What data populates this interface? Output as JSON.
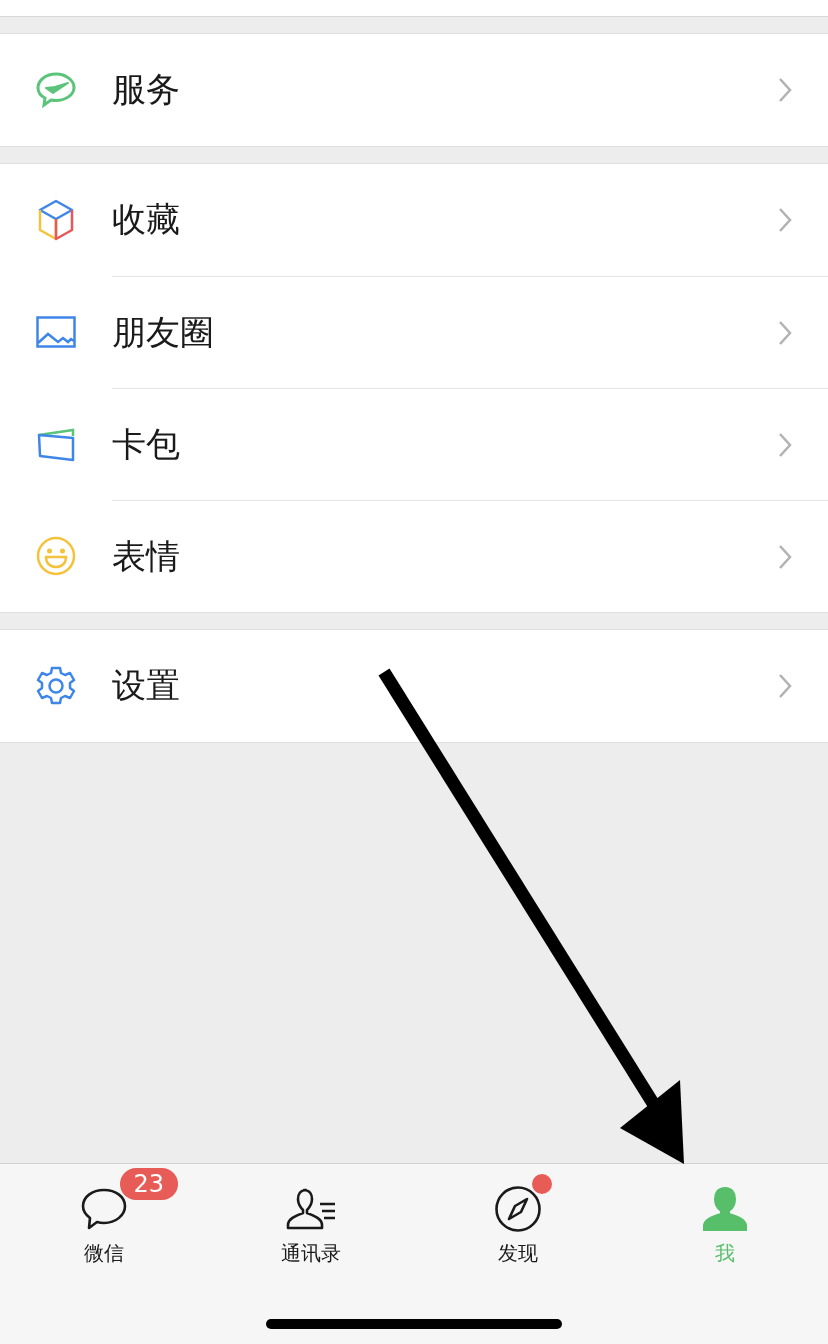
{
  "groups": [
    {
      "items": [
        {
          "kind": "services",
          "label": "服务"
        }
      ]
    },
    {
      "items": [
        {
          "kind": "favorites",
          "label": "收藏"
        },
        {
          "kind": "moments",
          "label": "朋友圈"
        },
        {
          "kind": "cards",
          "label": "卡包"
        },
        {
          "kind": "stickers",
          "label": "表情"
        }
      ]
    },
    {
      "items": [
        {
          "kind": "settings",
          "label": "设置"
        }
      ]
    }
  ],
  "tabs": [
    {
      "kind": "chats",
      "label": "微信",
      "selected": false,
      "badge": "23",
      "dot": false
    },
    {
      "kind": "contacts",
      "label": "通讯录",
      "selected": false,
      "dot": false
    },
    {
      "kind": "discover",
      "label": "发现",
      "selected": false,
      "dot": true
    },
    {
      "kind": "me",
      "label": "我",
      "selected": true,
      "dot": false
    }
  ]
}
